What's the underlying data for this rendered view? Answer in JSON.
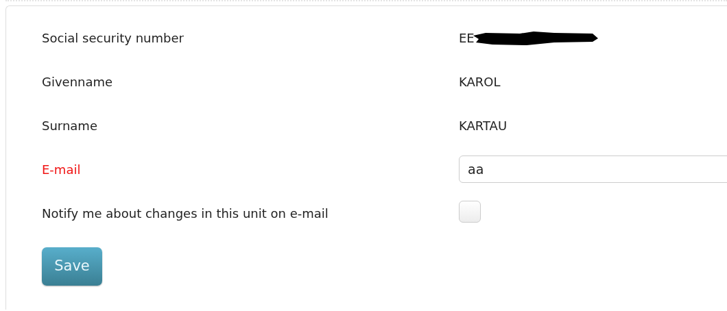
{
  "form": {
    "rows": [
      {
        "kind": "text",
        "label": "Social security number",
        "value": "EE",
        "redacted": true,
        "error": false
      },
      {
        "kind": "text",
        "label": "Givenname",
        "value": "KAROL",
        "redacted": false,
        "error": false
      },
      {
        "kind": "text",
        "label": "Surname",
        "value": "KARTAU",
        "redacted": false,
        "error": false
      },
      {
        "kind": "input",
        "label": "E-mail",
        "value": "aa",
        "error": true
      },
      {
        "kind": "checkbox",
        "label": "Notify me about changes in this unit on e-mail",
        "checked": false,
        "error": false
      }
    ],
    "buttons": [
      {
        "label": "Save"
      }
    ]
  }
}
